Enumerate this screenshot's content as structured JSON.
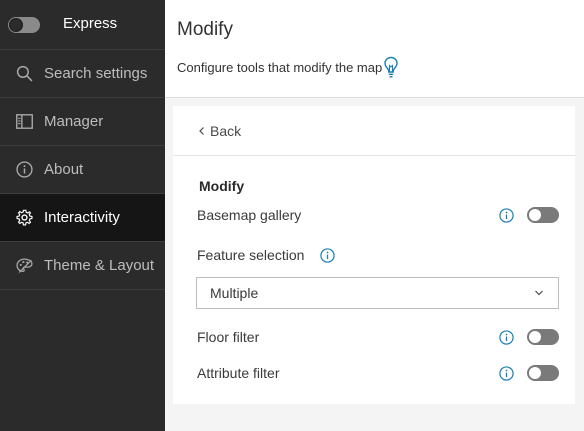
{
  "sidebar": {
    "mode_label": "Express",
    "items": [
      {
        "label": "Search settings",
        "icon": "search-icon"
      },
      {
        "label": "Manager",
        "icon": "panel-icon"
      },
      {
        "label": "About",
        "icon": "info-icon"
      },
      {
        "label": "Interactivity",
        "icon": "gear-icon",
        "active": true
      },
      {
        "label": "Theme & Layout",
        "icon": "palette-icon"
      }
    ]
  },
  "header": {
    "title": "Modify",
    "description": "Configure tools that modify the map",
    "icon": "lightbulb-icon"
  },
  "panel": {
    "back_label": "Back",
    "section_title": "Modify",
    "basemap_gallery": {
      "label": "Basemap gallery",
      "enabled": false
    },
    "feature_selection": {
      "label": "Feature selection",
      "value": "Multiple"
    },
    "floor_filter": {
      "label": "Floor filter",
      "enabled": false
    },
    "attribute_filter": {
      "label": "Attribute filter",
      "enabled": false
    }
  },
  "colors": {
    "sidebar_bg": "#2b2b2b",
    "sidebar_active_bg": "#151515",
    "accent_blue": "#1a7fb5",
    "toggle_off": "#7a7a7a"
  }
}
